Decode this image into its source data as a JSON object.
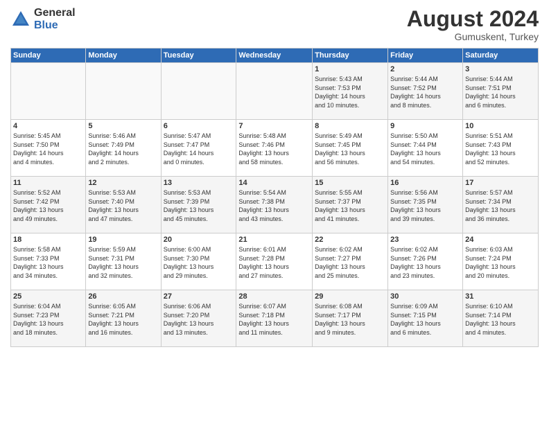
{
  "header": {
    "logo_general": "General",
    "logo_blue": "Blue",
    "title": "August 2024",
    "subtitle": "Gumuskent, Turkey"
  },
  "calendar": {
    "days_header": [
      "Sunday",
      "Monday",
      "Tuesday",
      "Wednesday",
      "Thursday",
      "Friday",
      "Saturday"
    ],
    "weeks": [
      [
        {
          "num": "",
          "info": ""
        },
        {
          "num": "",
          "info": ""
        },
        {
          "num": "",
          "info": ""
        },
        {
          "num": "",
          "info": ""
        },
        {
          "num": "1",
          "info": "Sunrise: 5:43 AM\nSunset: 7:53 PM\nDaylight: 14 hours\nand 10 minutes."
        },
        {
          "num": "2",
          "info": "Sunrise: 5:44 AM\nSunset: 7:52 PM\nDaylight: 14 hours\nand 8 minutes."
        },
        {
          "num": "3",
          "info": "Sunrise: 5:44 AM\nSunset: 7:51 PM\nDaylight: 14 hours\nand 6 minutes."
        }
      ],
      [
        {
          "num": "4",
          "info": "Sunrise: 5:45 AM\nSunset: 7:50 PM\nDaylight: 14 hours\nand 4 minutes."
        },
        {
          "num": "5",
          "info": "Sunrise: 5:46 AM\nSunset: 7:49 PM\nDaylight: 14 hours\nand 2 minutes."
        },
        {
          "num": "6",
          "info": "Sunrise: 5:47 AM\nSunset: 7:47 PM\nDaylight: 14 hours\nand 0 minutes."
        },
        {
          "num": "7",
          "info": "Sunrise: 5:48 AM\nSunset: 7:46 PM\nDaylight: 13 hours\nand 58 minutes."
        },
        {
          "num": "8",
          "info": "Sunrise: 5:49 AM\nSunset: 7:45 PM\nDaylight: 13 hours\nand 56 minutes."
        },
        {
          "num": "9",
          "info": "Sunrise: 5:50 AM\nSunset: 7:44 PM\nDaylight: 13 hours\nand 54 minutes."
        },
        {
          "num": "10",
          "info": "Sunrise: 5:51 AM\nSunset: 7:43 PM\nDaylight: 13 hours\nand 52 minutes."
        }
      ],
      [
        {
          "num": "11",
          "info": "Sunrise: 5:52 AM\nSunset: 7:42 PM\nDaylight: 13 hours\nand 49 minutes."
        },
        {
          "num": "12",
          "info": "Sunrise: 5:53 AM\nSunset: 7:40 PM\nDaylight: 13 hours\nand 47 minutes."
        },
        {
          "num": "13",
          "info": "Sunrise: 5:53 AM\nSunset: 7:39 PM\nDaylight: 13 hours\nand 45 minutes."
        },
        {
          "num": "14",
          "info": "Sunrise: 5:54 AM\nSunset: 7:38 PM\nDaylight: 13 hours\nand 43 minutes."
        },
        {
          "num": "15",
          "info": "Sunrise: 5:55 AM\nSunset: 7:37 PM\nDaylight: 13 hours\nand 41 minutes."
        },
        {
          "num": "16",
          "info": "Sunrise: 5:56 AM\nSunset: 7:35 PM\nDaylight: 13 hours\nand 39 minutes."
        },
        {
          "num": "17",
          "info": "Sunrise: 5:57 AM\nSunset: 7:34 PM\nDaylight: 13 hours\nand 36 minutes."
        }
      ],
      [
        {
          "num": "18",
          "info": "Sunrise: 5:58 AM\nSunset: 7:33 PM\nDaylight: 13 hours\nand 34 minutes."
        },
        {
          "num": "19",
          "info": "Sunrise: 5:59 AM\nSunset: 7:31 PM\nDaylight: 13 hours\nand 32 minutes."
        },
        {
          "num": "20",
          "info": "Sunrise: 6:00 AM\nSunset: 7:30 PM\nDaylight: 13 hours\nand 29 minutes."
        },
        {
          "num": "21",
          "info": "Sunrise: 6:01 AM\nSunset: 7:28 PM\nDaylight: 13 hours\nand 27 minutes."
        },
        {
          "num": "22",
          "info": "Sunrise: 6:02 AM\nSunset: 7:27 PM\nDaylight: 13 hours\nand 25 minutes."
        },
        {
          "num": "23",
          "info": "Sunrise: 6:02 AM\nSunset: 7:26 PM\nDaylight: 13 hours\nand 23 minutes."
        },
        {
          "num": "24",
          "info": "Sunrise: 6:03 AM\nSunset: 7:24 PM\nDaylight: 13 hours\nand 20 minutes."
        }
      ],
      [
        {
          "num": "25",
          "info": "Sunrise: 6:04 AM\nSunset: 7:23 PM\nDaylight: 13 hours\nand 18 minutes."
        },
        {
          "num": "26",
          "info": "Sunrise: 6:05 AM\nSunset: 7:21 PM\nDaylight: 13 hours\nand 16 minutes."
        },
        {
          "num": "27",
          "info": "Sunrise: 6:06 AM\nSunset: 7:20 PM\nDaylight: 13 hours\nand 13 minutes."
        },
        {
          "num": "28",
          "info": "Sunrise: 6:07 AM\nSunset: 7:18 PM\nDaylight: 13 hours\nand 11 minutes."
        },
        {
          "num": "29",
          "info": "Sunrise: 6:08 AM\nSunset: 7:17 PM\nDaylight: 13 hours\nand 9 minutes."
        },
        {
          "num": "30",
          "info": "Sunrise: 6:09 AM\nSunset: 7:15 PM\nDaylight: 13 hours\nand 6 minutes."
        },
        {
          "num": "31",
          "info": "Sunrise: 6:10 AM\nSunset: 7:14 PM\nDaylight: 13 hours\nand 4 minutes."
        }
      ]
    ]
  }
}
